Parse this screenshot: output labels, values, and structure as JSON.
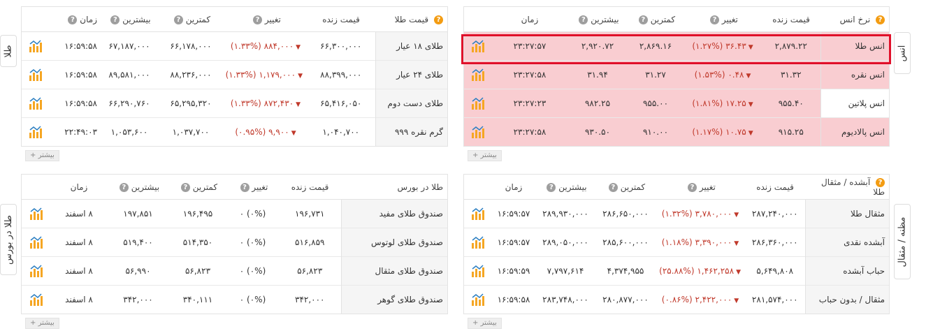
{
  "more_label": "بیشتر",
  "gold": {
    "tab": "طلا",
    "headers": {
      "name": "قیمت طلا",
      "live": "قیمت زنده",
      "change": "تغییر",
      "low": "کمترین",
      "high": "بیشترین",
      "time": "زمان"
    },
    "rows": [
      {
        "name": "طلای ۱۸ عیار",
        "live": "۶۶,۳۰۰,۰۰۰",
        "change": "۸۸۴,۰۰۰ (۱.۳۳%)",
        "low": "۶۶,۱۷۸,۰۰۰",
        "high": "۶۷,۱۸۷,۰۰۰",
        "time": "۱۶:۵۹:۵۸"
      },
      {
        "name": "طلای ۲۴ عیار",
        "live": "۸۸,۳۹۹,۰۰۰",
        "change": "۱,۱۷۹,۰۰۰ (۱.۳۳%)",
        "low": "۸۸,۲۳۶,۰۰۰",
        "high": "۸۹,۵۸۱,۰۰۰",
        "time": "۱۶:۵۹:۵۸"
      },
      {
        "name": "طلای دست دوم",
        "live": "۶۵,۴۱۶,۰۵۰",
        "change": "۸۷۲,۴۳۰ (۱.۳۳%)",
        "low": "۶۵,۲۹۵,۳۲۰",
        "high": "۶۶,۲۹۰,۷۶۰",
        "time": "۱۶:۵۹:۵۸"
      },
      {
        "name": "گرم نقره ۹۹۹",
        "live": "۱,۰۴۰,۷۰۰",
        "change": "۹,۹۰۰ (۰.۹۵%)",
        "low": "۱,۰۳۷,۷۰۰",
        "high": "۱,۰۵۳,۶۰۰",
        "time": "۲۲:۴۹:۰۳"
      }
    ]
  },
  "ounce": {
    "tab": "انس",
    "headers": {
      "name": "نرخ انس",
      "live": "قیمت زنده",
      "change": "تغییر",
      "low": "کمترین",
      "high": "بیشترین",
      "time": "زمان"
    },
    "rows": [
      {
        "name": "انس طلا",
        "live": "۲,۸۷۹.۲۲",
        "change": "۳۶.۴۳ (۱.۲۷%)",
        "low": "۲,۸۶۹.۱۶",
        "high": "۲,۹۲۰.۷۲",
        "time": "۲۳:۲۷:۵۷"
      },
      {
        "name": "انس نقره",
        "live": "۳۱.۳۲",
        "change": "۰.۴۸ (۱.۵۳%)",
        "low": "۳۱.۲۷",
        "high": "۳۱.۹۴",
        "time": "۲۳:۲۷:۵۸"
      },
      {
        "name": "انس پلاتین",
        "live": "۹۵۵.۴۰",
        "change": "۱۷.۲۵ (۱.۸۱%)",
        "low": "۹۵۵.۰۰",
        "high": "۹۸۲.۲۵",
        "time": "۲۳:۲۷:۲۳"
      },
      {
        "name": "انس پالادیوم",
        "live": "۹۱۵.۲۵",
        "change": "۱۰.۷۵ (۱.۱۷%)",
        "low": "۹۱۰.۰۰",
        "high": "۹۳۰.۵۰",
        "time": "۲۳:۲۷:۵۸"
      }
    ]
  },
  "bourse": {
    "tab": "طلا در بورس",
    "headers": {
      "name": "طلا در بورس",
      "live": "قیمت زنده",
      "change": "تغییر",
      "low": "کمترین",
      "high": "بیشترین",
      "time": "زمان"
    },
    "rows": [
      {
        "name": "صندوق طلای مفید",
        "live": "۱۹۶,۷۳۱",
        "change": "(۰%) ۰",
        "low": "۱۹۶,۴۹۵",
        "high": "۱۹۷,۸۵۱",
        "time": "۸ اسفند"
      },
      {
        "name": "صندوق طلای لوتوس",
        "live": "۵۱۶,۸۵۹",
        "change": "(۰%) ۰",
        "low": "۵۱۴,۳۵۰",
        "high": "۵۱۹,۴۰۰",
        "time": "۸ اسفند"
      },
      {
        "name": "صندوق طلای مثقال",
        "live": "۵۶,۸۲۳",
        "change": "(۰%) ۰",
        "low": "۵۶,۸۲۳",
        "high": "۵۶,۹۹۰",
        "time": "۸ اسفند"
      },
      {
        "name": "صندوق طلای گوهر",
        "live": "۳۴۲,۰۰۰",
        "change": "(۰%) ۰",
        "low": "۳۴۰,۱۱۱",
        "high": "۳۴۲,۰۰۰",
        "time": "۸ اسفند"
      }
    ]
  },
  "mesghal": {
    "tab": "مظنه / مثقال",
    "headers": {
      "name": "آبشده / مثقال طلا",
      "live": "قیمت زنده",
      "change": "تغییر",
      "low": "کمترین",
      "high": "بیشترین",
      "time": "زمان"
    },
    "rows": [
      {
        "name": "مثقال طلا",
        "live": "۲۸۷,۲۴۰,۰۰۰",
        "change": "۳,۷۸۰,۰۰۰ (۱.۳۲%)",
        "low": "۲۸۶,۶۵۰,۰۰۰",
        "high": "۲۸۹,۹۳۰,۰۰۰",
        "time": "۱۶:۵۹:۵۷"
      },
      {
        "name": "آبشده نقدی",
        "live": "۲۸۶,۳۶۰,۰۰۰",
        "change": "۳,۳۹۰,۰۰۰ (۱.۱۸%)",
        "low": "۲۸۵,۶۰۰,۰۰۰",
        "high": "۲۸۹,۰۵۰,۰۰۰",
        "time": "۱۶:۵۹:۵۷"
      },
      {
        "name": "حباب آبشده",
        "live": "۵,۶۴۹,۸۰۸",
        "change": "۱,۴۶۲,۲۵۸ (۲۵.۸۸%)",
        "low": "۴,۳۷۴,۹۵۵",
        "high": "۷,۷۹۷,۶۱۴",
        "time": "۱۶:۵۹:۵۹"
      },
      {
        "name": "مثقال / بدون حباب",
        "live": "۲۸۱,۵۷۴,۰۰۰",
        "change": "۲,۴۲۲,۰۰۰ (۰.۸۶%)",
        "low": "۲۸۰,۸۷۷,۰۰۰",
        "high": "۲۸۳,۷۴۸,۰۰۰",
        "time": "۱۶:۵۹:۵۸"
      }
    ]
  }
}
